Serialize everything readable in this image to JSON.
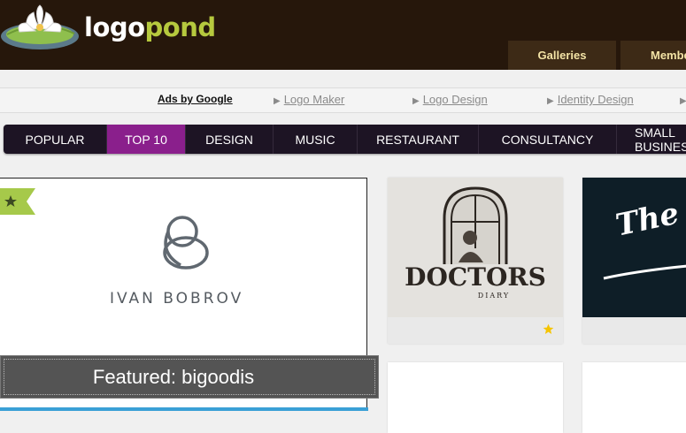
{
  "brand": {
    "logo_part1": "logo",
    "logo_part2": "pond"
  },
  "header_tabs": {
    "galleries": "Galleries",
    "members": "Members"
  },
  "ads": {
    "label": "Ads by Google",
    "links": [
      "Logo Maker",
      "Logo Design",
      "Identity Design"
    ]
  },
  "categories": [
    "POPULAR",
    "TOP 10",
    "DESIGN",
    "MUSIC",
    "RESTAURANT",
    "CONSULTANCY",
    "SMALL BUSINESS"
  ],
  "active_category": "TOP 10",
  "featured": {
    "brand_name": "IVAN BOBROV",
    "caption": "Featured: bigoodis"
  },
  "thumbnails": [
    {
      "title": "DOCTORS",
      "subtitle": "DIARY",
      "starred": true
    },
    {
      "title": "The Challe",
      "starred": false
    }
  ],
  "colors": {
    "header_bg": "#26170b",
    "nav_bg": "#1d1424",
    "nav_active": "#8a1f8c",
    "logo_accent": "#b6c93e",
    "ribbon": "#a6c94a",
    "star": "#f5c400"
  }
}
